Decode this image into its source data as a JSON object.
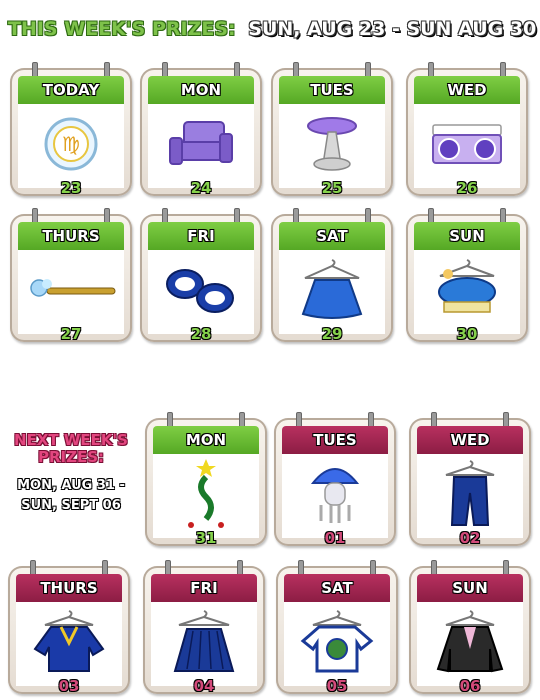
{
  "header": {
    "title": "THIS WEEK'S PRIZES:",
    "range": "SUN, AUG 23 - SUN AUG 30"
  },
  "this_week": [
    {
      "day": "TODAY",
      "date": "23",
      "prize_icon": "zodiac-coin-icon"
    },
    {
      "day": "MON",
      "date": "24",
      "prize_icon": "armchair-icon"
    },
    {
      "day": "TUES",
      "date": "25",
      "prize_icon": "round-table-icon"
    },
    {
      "day": "WED",
      "date": "26",
      "prize_icon": "speaker-bench-icon"
    },
    {
      "day": "THURS",
      "date": "27",
      "prize_icon": "wand-icon"
    },
    {
      "day": "FRI",
      "date": "28",
      "prize_icon": "cuffs-icon"
    },
    {
      "day": "SAT",
      "date": "29",
      "prize_icon": "skirt-icon"
    },
    {
      "day": "SUN",
      "date": "30",
      "prize_icon": "tutu-icon"
    }
  ],
  "next_week": {
    "title_line1": "NEXT WEEK'S",
    "title_line2": "PRIZES:",
    "range_line1": "MON, AUG 31 -",
    "range_line2": "SUN, SEPT 06",
    "days": [
      {
        "day": "MON",
        "date": "31",
        "prize_icon": "vine-plant-icon"
      },
      {
        "day": "TUES",
        "date": "01",
        "prize_icon": "jellyfish-icon"
      },
      {
        "day": "WED",
        "date": "02",
        "prize_icon": "pants-icon"
      },
      {
        "day": "THURS",
        "date": "03",
        "prize_icon": "sweater-icon"
      },
      {
        "day": "FRI",
        "date": "04",
        "prize_icon": "pleated-skirt-icon"
      },
      {
        "day": "SAT",
        "date": "05",
        "prize_icon": "tshirt-icon"
      },
      {
        "day": "SUN",
        "date": "06",
        "prize_icon": "suit-jacket-icon"
      }
    ]
  },
  "colors": {
    "this_week_header": "#5fb52d",
    "next_week_header": "#9e2450"
  }
}
